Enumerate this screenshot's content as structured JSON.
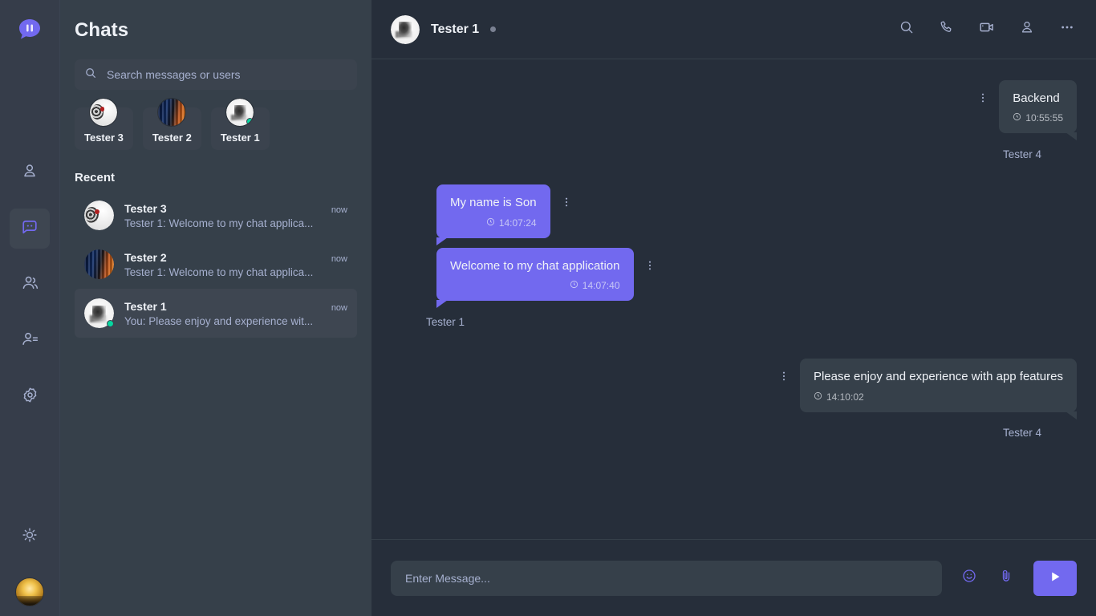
{
  "app": {
    "logo_icon": "chat-logo-icon",
    "accent_color": "#7269ef",
    "bubble_incoming_color": "#7269ef",
    "bubble_outgoing_color": "#36404a",
    "sidebar_color": "#36404a",
    "chat_bg_color": "#262e3a",
    "rail_color": "#363d4a",
    "online_color": "#06d6a0"
  },
  "rail": {
    "items": [
      {
        "name": "profile",
        "icon": "user-icon",
        "active": false
      },
      {
        "name": "chats",
        "icon": "chat-bubble-icon",
        "active": true
      },
      {
        "name": "groups",
        "icon": "users-group-icon",
        "active": false
      },
      {
        "name": "contacts",
        "icon": "contact-list-icon",
        "active": false
      },
      {
        "name": "settings",
        "icon": "gear-icon",
        "active": false
      }
    ],
    "theme_toggle_icon": "sun-icon",
    "profile_avatar": "avatar-current-user"
  },
  "sidebar": {
    "title": "Chats",
    "search": {
      "placeholder": "Search messages or users",
      "value": "",
      "icon": "search-icon"
    },
    "stories": [
      {
        "name": "Tester 3",
        "avatar": "av-t3",
        "online": false
      },
      {
        "name": "Tester 2",
        "avatar": "av-t2",
        "online": false
      },
      {
        "name": "Tester 1",
        "avatar": "av-t1",
        "online": true
      }
    ],
    "recent_label": "Recent",
    "recent": [
      {
        "name": "Tester 3",
        "preview": "Tester 1: Welcome to my chat applica...",
        "time": "now",
        "avatar": "av-t3",
        "online": false,
        "active": false
      },
      {
        "name": "Tester 2",
        "preview": "Tester 1: Welcome to my chat applica...",
        "time": "now",
        "avatar": "av-t2",
        "online": false,
        "active": false
      },
      {
        "name": "Tester 1",
        "preview": "You: Please enjoy and experience wit...",
        "time": "now",
        "avatar": "av-t1",
        "online": true,
        "active": true
      }
    ]
  },
  "chat": {
    "peer_name": "Tester 1",
    "peer_status": "offline",
    "actions": [
      {
        "name": "search",
        "icon": "search-icon"
      },
      {
        "name": "voice-call",
        "icon": "phone-icon"
      },
      {
        "name": "video-call",
        "icon": "video-camera-icon"
      },
      {
        "name": "contact-info",
        "icon": "user-icon"
      },
      {
        "name": "more-options",
        "icon": "ellipsis-horizontal-icon"
      }
    ],
    "messages": [
      {
        "text": "Backend",
        "time": "10:55:55",
        "sender": "Tester 4",
        "direction": "outgoing",
        "avatar": "av-t4"
      },
      {
        "text": "My name is Son",
        "time": "14:07:24",
        "sender": "Tester 1",
        "direction": "incoming",
        "avatar": "av-t1"
      },
      {
        "text": "Welcome to my chat application",
        "time": "14:07:40",
        "sender": "Tester 1",
        "direction": "incoming",
        "avatar": "av-t1"
      },
      {
        "text": "Please enjoy and experience with app features",
        "time": "14:10:02",
        "sender": "Tester 4",
        "direction": "outgoing",
        "avatar": "av-t4"
      }
    ]
  },
  "composer": {
    "placeholder": "Enter Message...",
    "value": "",
    "emoji_icon": "emoji-smiley-icon",
    "attach_icon": "paperclip-icon",
    "send_icon": "send-play-icon"
  }
}
